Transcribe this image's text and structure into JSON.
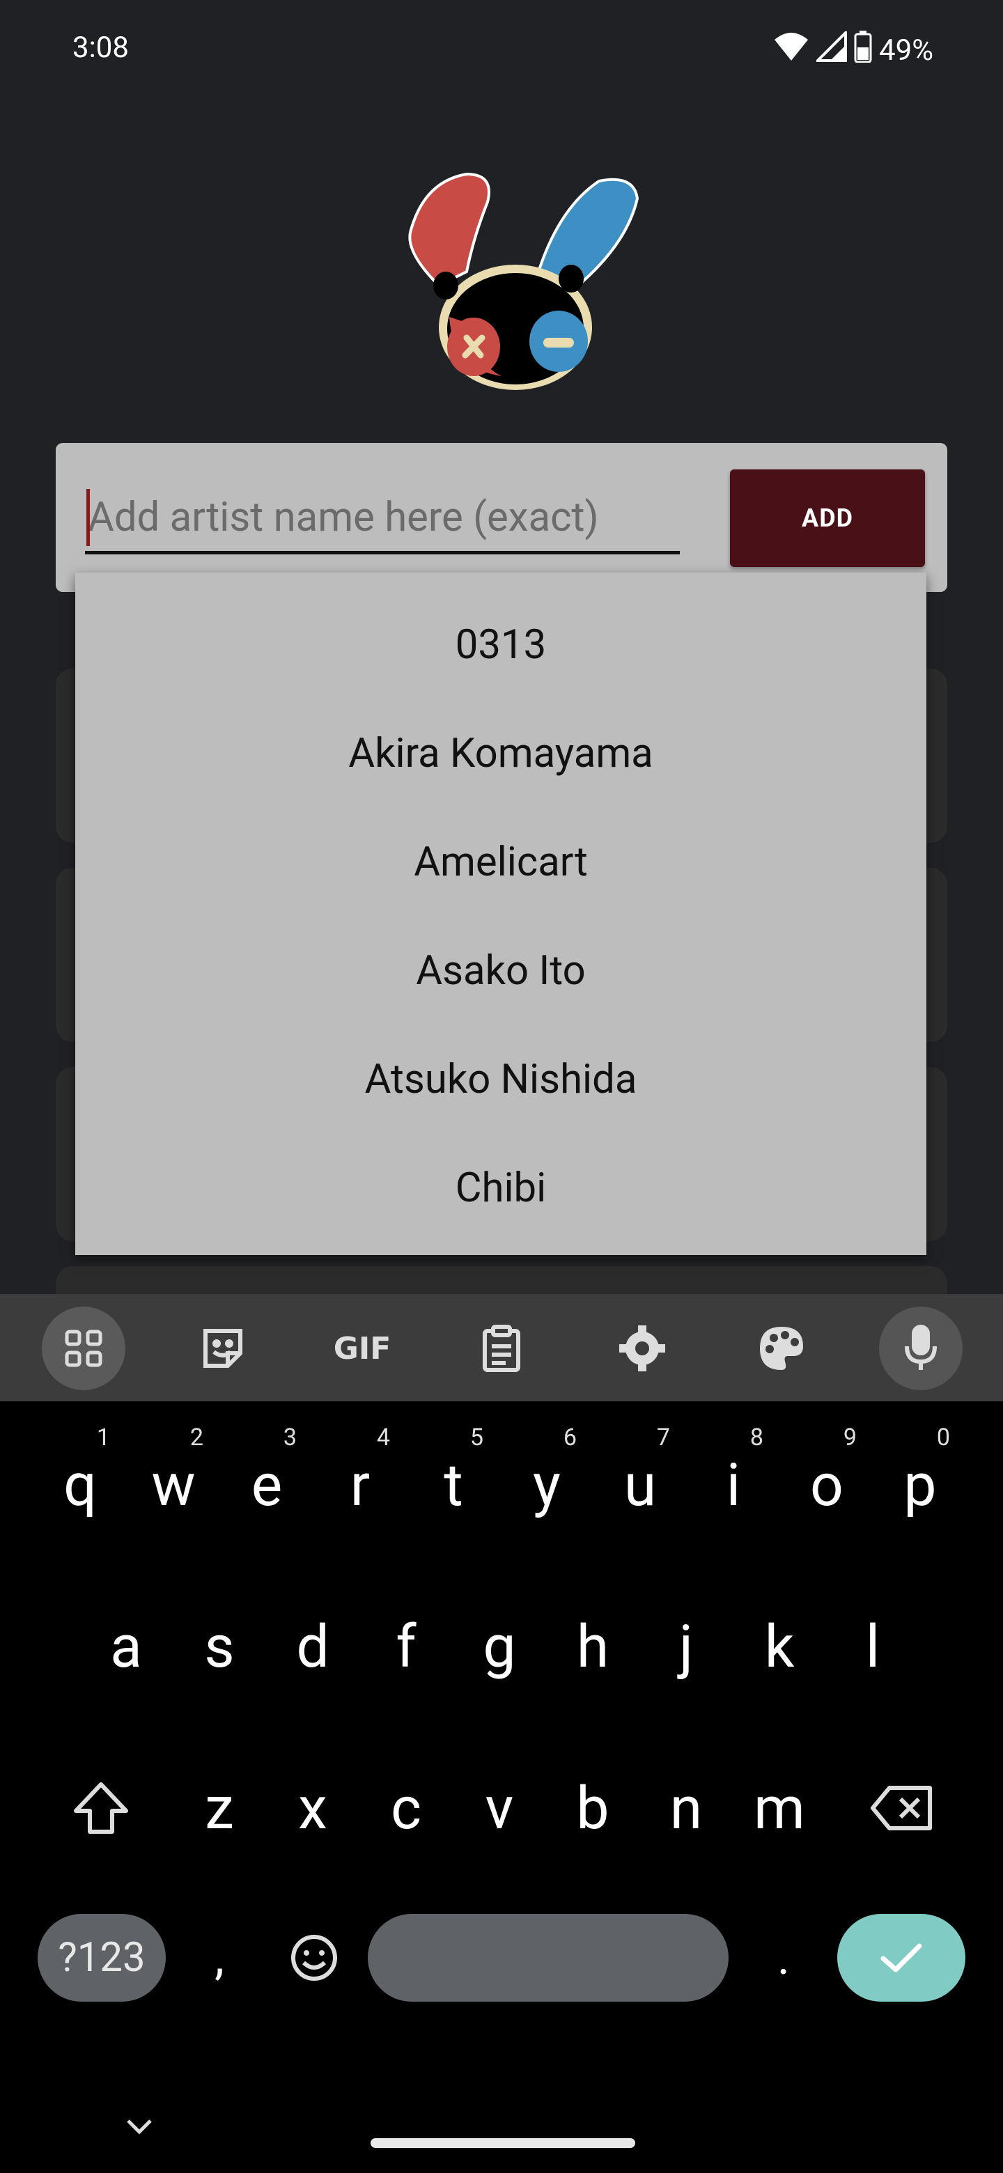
{
  "status_bar": {
    "time": "3:08",
    "battery_percent": "49%",
    "icons": [
      "wifi-icon",
      "signal-icon",
      "battery-icon"
    ]
  },
  "logo": {
    "icon": "bunny-logo-icon",
    "colors": {
      "left_ear": "#c94b46",
      "right_ear": "#3d8fc4",
      "face": "#000000",
      "outline": "#e8dcb0"
    }
  },
  "artist_form": {
    "input_value": "",
    "input_placeholder": "Add artist name here (exact)",
    "add_label": "ADD",
    "add_color": "#4a1017"
  },
  "dropdown": {
    "items": [
      "0313",
      "Akira Komayama",
      "Amelicart",
      "Asako Ito",
      "Atsuko Nishida",
      "Chibi"
    ]
  },
  "keyboard": {
    "toolbar": [
      "apps-grid-icon",
      "sticker-icon",
      "gif-icon",
      "clipboard-icon",
      "settings-icon",
      "palette-icon",
      "microphone-icon"
    ],
    "gif_label": "GIF",
    "row1": [
      {
        "key": "q",
        "hint": "1"
      },
      {
        "key": "w",
        "hint": "2"
      },
      {
        "key": "e",
        "hint": "3"
      },
      {
        "key": "r",
        "hint": "4"
      },
      {
        "key": "t",
        "hint": "5"
      },
      {
        "key": "y",
        "hint": "6"
      },
      {
        "key": "u",
        "hint": "7"
      },
      {
        "key": "i",
        "hint": "8"
      },
      {
        "key": "o",
        "hint": "9"
      },
      {
        "key": "p",
        "hint": "0"
      }
    ],
    "row2": [
      "a",
      "s",
      "d",
      "f",
      "g",
      "h",
      "j",
      "k",
      "l"
    ],
    "row3": [
      "z",
      "x",
      "c",
      "v",
      "b",
      "n",
      "m"
    ],
    "symbols_label": "?123",
    "comma_label": ",",
    "period_label": ".",
    "enter_color": "#80cbc4"
  }
}
